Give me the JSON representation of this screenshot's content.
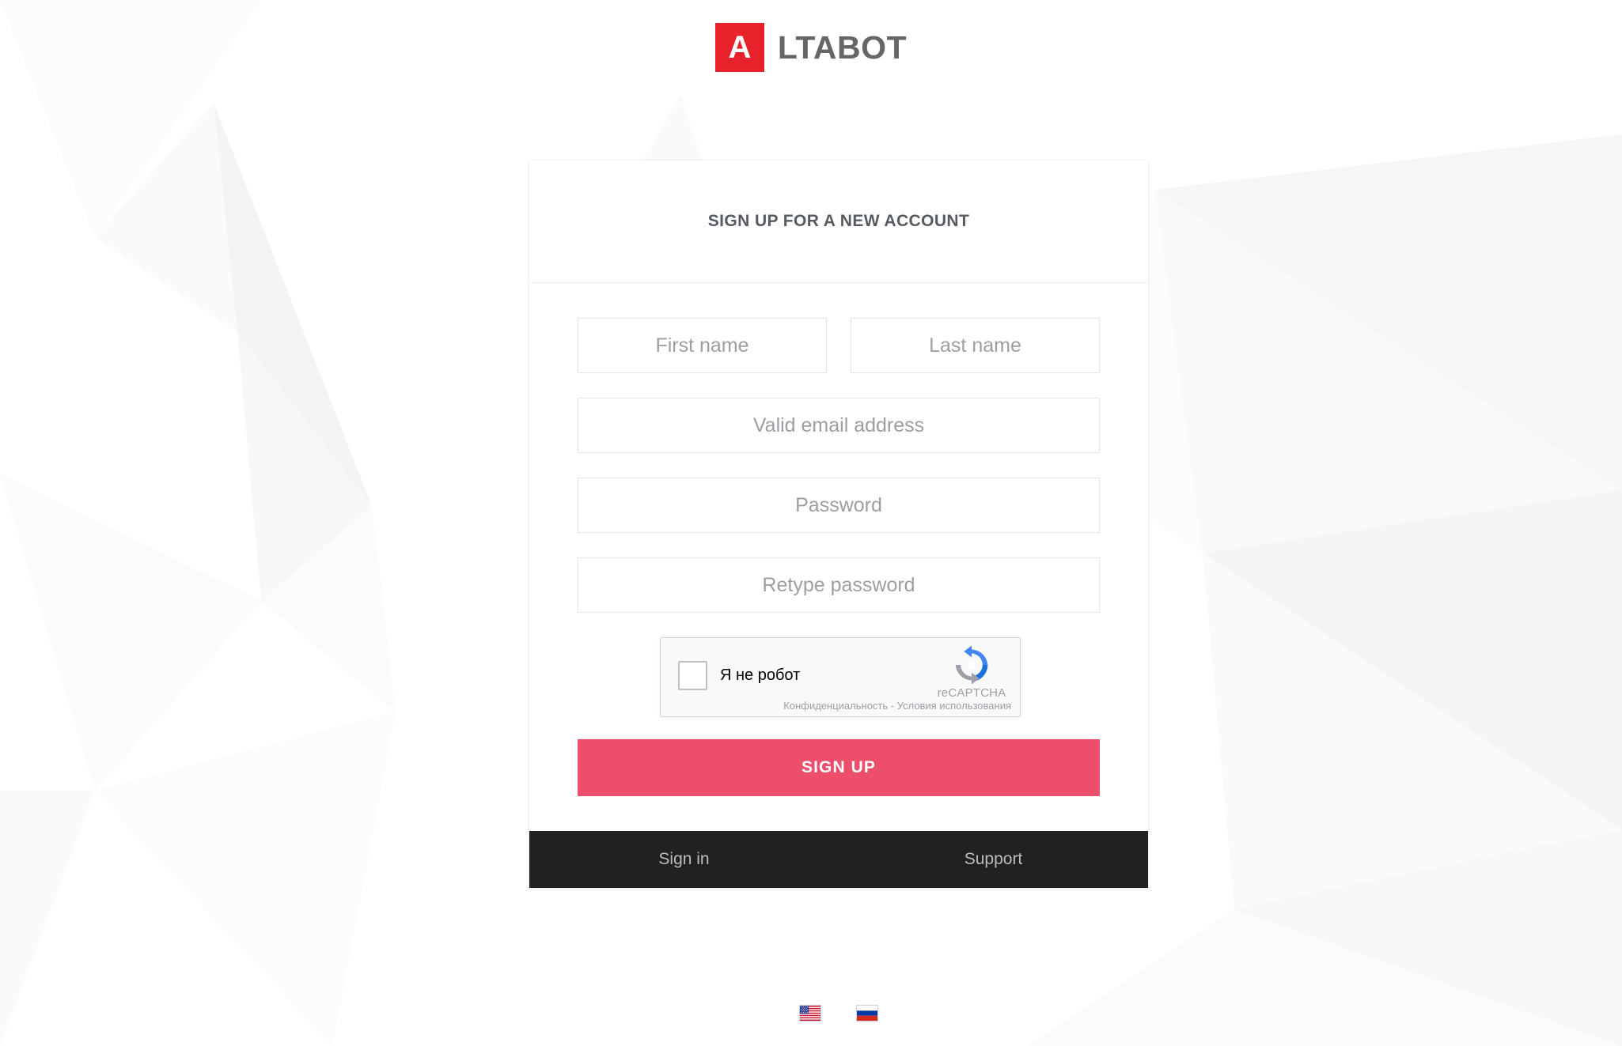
{
  "brand": {
    "mark_letter": "A",
    "word": "LTABOT",
    "mark_bg": "#e8222a",
    "word_color": "#666666"
  },
  "card": {
    "title": "SIGN UP FOR A NEW ACCOUNT",
    "fields": {
      "first_name": {
        "value": "",
        "placeholder": "First name"
      },
      "last_name": {
        "value": "",
        "placeholder": "Last name"
      },
      "email": {
        "value": "",
        "placeholder": "Valid email address"
      },
      "password": {
        "value": "",
        "placeholder": "Password"
      },
      "retype_password": {
        "value": "",
        "placeholder": "Retype password"
      }
    },
    "recaptcha": {
      "checkbox_label": "Я не робот",
      "brand_name": "reCAPTCHA",
      "privacy_label": "Конфиденциальность",
      "separator": "-",
      "terms_label": "Условия использования",
      "legal_line": "Конфиденциальность - Условия использования",
      "checked": false,
      "logo_blue": "#1c71d8",
      "logo_lightblue": "#4285f4",
      "logo_gray": "#9aa0a6"
    },
    "submit_label": "SIGN UP",
    "submit_color": "#ec4e6c",
    "footer": {
      "sign_in_label": "Sign in",
      "support_label": "Support",
      "background": "#212121"
    }
  },
  "language_bar": {
    "languages": [
      {
        "name": "english",
        "icon": "us-flag-icon",
        "selected": true
      },
      {
        "name": "russian",
        "icon": "ru-flag-icon",
        "selected": false
      }
    ]
  }
}
